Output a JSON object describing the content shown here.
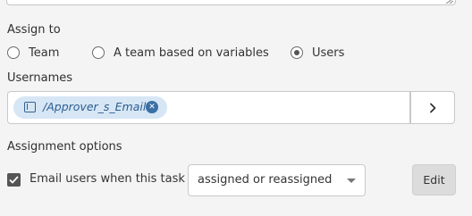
{
  "assign_section": {
    "title": "Assign to",
    "options": [
      {
        "label": "Team",
        "checked": false
      },
      {
        "label": "A team based on variables",
        "checked": false
      },
      {
        "label": "Users",
        "checked": true
      }
    ]
  },
  "usernames": {
    "label": "Usernames",
    "chips": [
      {
        "label": "/Approver_s_Email",
        "icon": "variable-icon",
        "remove_icon": "close-circle-icon"
      }
    ],
    "expand_icon": "chevron-right-icon"
  },
  "assignment_options": {
    "title": "Assignment options",
    "email_checkbox": {
      "checked": true,
      "label": "Email users when this task is"
    },
    "email_trigger": {
      "selected": "assigned or reassigned"
    },
    "edit_label": "Edit"
  }
}
